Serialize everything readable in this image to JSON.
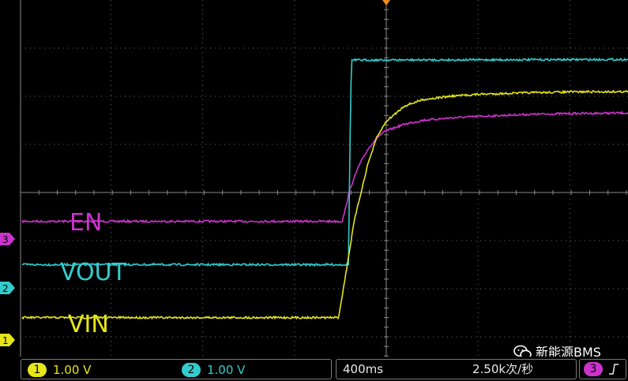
{
  "chart_data": {
    "type": "line",
    "title": "",
    "xlabel": "",
    "ylabel": "",
    "grid": true,
    "series": [
      {
        "name": "EN",
        "channel": "3",
        "color": "#cc33cc",
        "x": [
          -4,
          -0.48,
          -0.44,
          -0.4,
          -0.3,
          -0.2,
          -0.1,
          0,
          0.2,
          0.4,
          0.7,
          1.0,
          1.5,
          2.0,
          3.0,
          4.0
        ],
        "y": [
          -0.6,
          -0.6,
          -0.3,
          0.05,
          0.55,
          0.9,
          1.15,
          1.28,
          1.42,
          1.5,
          1.55,
          1.58,
          1.62,
          1.64,
          1.66,
          1.67
        ]
      },
      {
        "name": "VOUT",
        "channel": "2",
        "color": "#33cccc",
        "x": [
          -4,
          -0.41,
          -0.4,
          -0.38,
          4.0
        ],
        "y": [
          -1.5,
          -1.5,
          0.5,
          2.75,
          2.77
        ]
      },
      {
        "name": "VIN",
        "channel": "1",
        "color": "#e6e619",
        "x": [
          -4,
          -0.52,
          -0.45,
          -0.35,
          -0.2,
          -0.1,
          0,
          0.2,
          0.4,
          0.7,
          1.0,
          1.5,
          2.0,
          3.0,
          4.0
        ],
        "y": [
          -2.6,
          -2.6,
          -1.8,
          -0.6,
          0.6,
          1.15,
          1.48,
          1.8,
          1.93,
          2.0,
          2.04,
          2.07,
          2.09,
          2.1,
          2.1
        ]
      }
    ],
    "labels": {
      "en": "EN",
      "vout": "VOUT",
      "vin": "VIN"
    },
    "markers": {
      "ch1": "1",
      "ch2": "2",
      "ch3": "3"
    }
  },
  "status": {
    "ch1_badge": "1",
    "ch1_scale": "1.00 V",
    "ch2_badge": "2",
    "ch2_scale": "1.00 V",
    "timebase": "400ms",
    "sample_rate": "2.50k次/秒",
    "trigger_badge": "3",
    "trigger_icon": "rising-edge-icon"
  },
  "watermark": {
    "text": "新能源BMS",
    "icon": "wechat-icon"
  }
}
